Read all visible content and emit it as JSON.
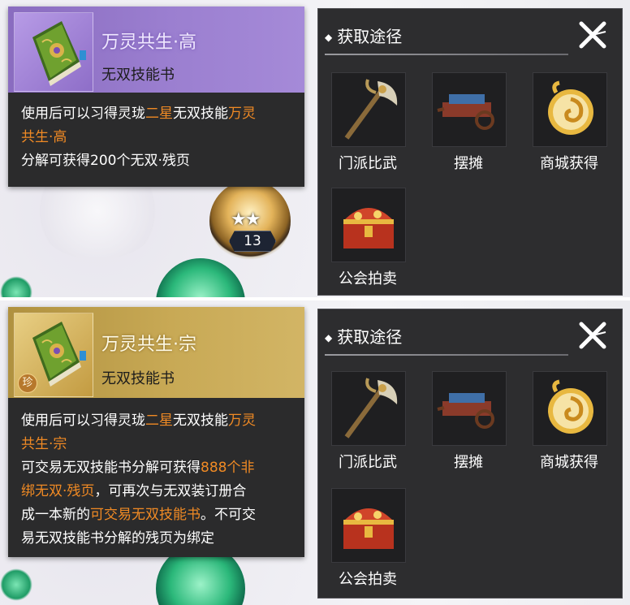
{
  "panels": [
    {
      "item": {
        "name_prefix": "万灵共生",
        "name_suffix": "·高",
        "type": "无双技能书",
        "rarity_badge": ""
      },
      "description": {
        "line1_a": "使用后可以习得灵珑",
        "line1_b": "二星",
        "line1_c": "无双技能",
        "line1_d": "万灵",
        "line2_a": "共生·高",
        "line3": "分解可获得200个无双·残页"
      },
      "skill_level": "13",
      "acquire": {
        "title": "获取途径",
        "sources": [
          {
            "label": "门派比武",
            "icon": "axe-weapon-icon"
          },
          {
            "label": "摆摊",
            "icon": "vendor-cart-icon"
          },
          {
            "label": "商城获得",
            "icon": "gold-swirl-coin-icon"
          },
          {
            "label": "公会拍卖",
            "icon": "treasure-chest-icon"
          }
        ]
      }
    },
    {
      "item": {
        "name_prefix": "万灵共生",
        "name_suffix": "·宗",
        "type": "无双技能书",
        "rarity_badge": "珍"
      },
      "description": {
        "line1_a": "使用后可以习得灵珑",
        "line1_b": "二星",
        "line1_c": "无双技能",
        "line1_d": "万灵",
        "line2_a": "共生·宗",
        "line3_a": "可交易无双技能书分解可获得",
        "line3_b": "888个非",
        "line4_a": "绑无双·残页",
        "line4_b": "，可再次与无双装订册合",
        "line5_a": "成一本新的",
        "line5_b": "可交易无双技能书",
        "line5_c": "。不可交",
        "line6": "易无双技能书分解的残页为绑定"
      },
      "acquire": {
        "title": "获取途径",
        "sources": [
          {
            "label": "门派比武",
            "icon": "axe-weapon-icon"
          },
          {
            "label": "摆摊",
            "icon": "vendor-cart-icon"
          },
          {
            "label": "商城获得",
            "icon": "gold-swirl-coin-icon"
          },
          {
            "label": "公会拍卖",
            "icon": "treasure-chest-icon"
          }
        ]
      }
    }
  ],
  "colors": {
    "highlight": "#f08a24",
    "purple_header": "#9b7fd0",
    "gold_header": "#c8a955",
    "panel_bg": "#2d2d2f"
  }
}
